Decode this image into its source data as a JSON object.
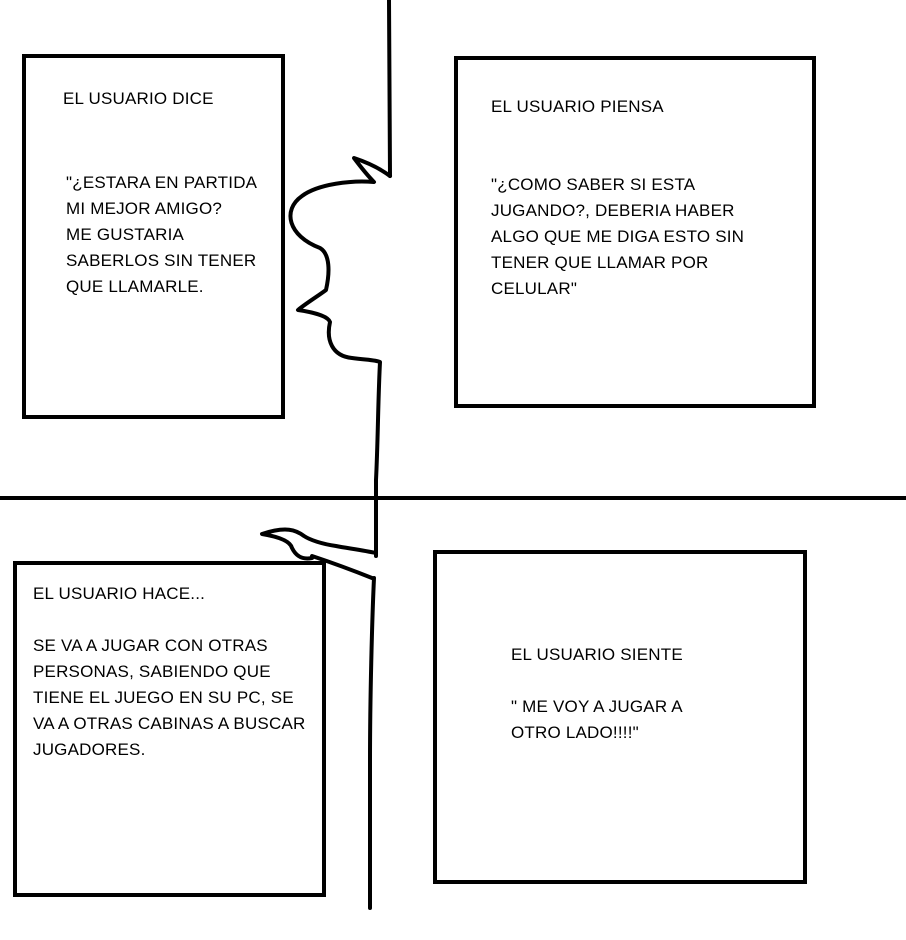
{
  "panels": {
    "dice": {
      "heading": "EL USUARIO DICE",
      "quote": "\"¿ESTARA EN PARTIDA\nMI MEJOR AMIGO?\nME GUSTARIA\nSABERLOS SIN TENER\nQUE LLAMARLE."
    },
    "piensa": {
      "heading": "EL USUARIO PIENSA",
      "quote": "\"¿COMO SABER SI ESTA\nJUGANDO?, DEBERIA HABER\nALGO QUE ME DIGA ESTO SIN\nTENER QUE LLAMAR POR\nCELULAR\""
    },
    "hace": {
      "heading": "EL USUARIO HACE...",
      "quote": "SE VA A JUGAR CON OTRAS\nPERSONAS, SABIENDO QUE\nTIENE EL JUEGO EN SU PC, SE\nVA A OTRAS CABINAS A BUSCAR\nJUGADORES."
    },
    "siente": {
      "heading": "EL USUARIO SIENTE",
      "quote": "\" ME VOY A JUGAR A\nOTRO LADO!!!!\""
    }
  },
  "colors": {
    "ink": "#000000",
    "paper": "#ffffff"
  }
}
